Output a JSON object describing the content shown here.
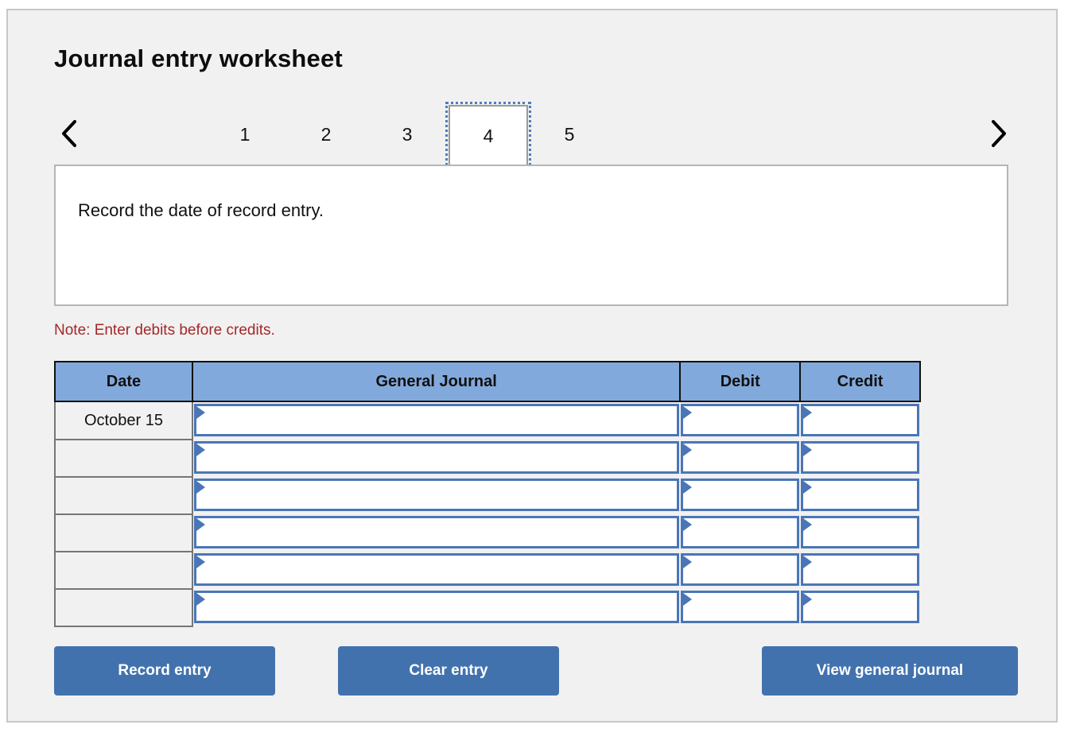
{
  "page": {
    "title": "Journal entry worksheet",
    "background_color": "#f1f1f1",
    "border_color": "#c7c7c7"
  },
  "pager": {
    "prev_icon": "chevron-left-icon",
    "next_icon": "chevron-right-icon",
    "pages": [
      "1",
      "2",
      "3",
      "4",
      "5"
    ],
    "selected": "4",
    "focus_ring_color": "#4a7ebb"
  },
  "instruction": {
    "text": "Record the date of record entry."
  },
  "note": {
    "text": "Note: Enter debits before credits.",
    "color": "#a52727"
  },
  "journal": {
    "header_color": "#82a9db",
    "input_border_color": "#4a76b8",
    "columns": [
      "Date",
      "General Journal",
      "Debit",
      "Credit"
    ],
    "rows": [
      {
        "date": "October 15",
        "general_journal": "",
        "debit": "",
        "credit": ""
      },
      {
        "date": "",
        "general_journal": "",
        "debit": "",
        "credit": ""
      },
      {
        "date": "",
        "general_journal": "",
        "debit": "",
        "credit": ""
      },
      {
        "date": "",
        "general_journal": "",
        "debit": "",
        "credit": ""
      },
      {
        "date": "",
        "general_journal": "",
        "debit": "",
        "credit": ""
      },
      {
        "date": "",
        "general_journal": "",
        "debit": "",
        "credit": ""
      }
    ]
  },
  "buttons": {
    "record": "Record entry",
    "clear": "Clear entry",
    "view": "View general journal",
    "color": "#4272ae"
  }
}
